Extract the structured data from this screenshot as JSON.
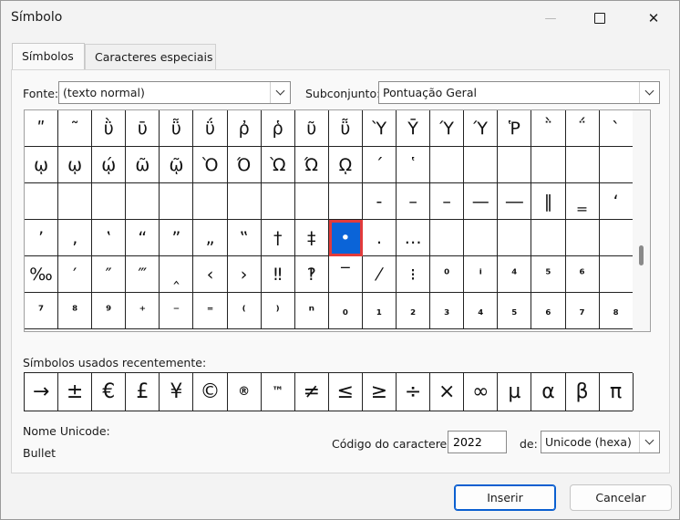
{
  "window": {
    "title": "Símbolo",
    "minimize_glyph": "—",
    "maximize_glyph": "☐",
    "close_glyph": "✕"
  },
  "tabs": [
    {
      "label": "Símbolos",
      "active": true
    },
    {
      "label": "Caracteres especiais",
      "active": false
    }
  ],
  "font": {
    "label": "Fonte:",
    "value": "(texto normal)"
  },
  "subset": {
    "label": "Subconjunto:",
    "value": "Pontuação Geral"
  },
  "symbol_grid": {
    "rows": [
      [
        "ʺ",
        "῀",
        "ῢ",
        "ῡ",
        "ῧ",
        "ΰ",
        "ῤ",
        "ῥ",
        "ῦ",
        "ῧ",
        "Ὺ",
        "Ῡ",
        "Ύ",
        "Ύ",
        "Ῥ",
        "῭",
        "΅",
        "`"
      ],
      [
        "ῳ",
        "ῳ",
        "ῴ",
        "ῶ",
        "ῷ",
        "Ὸ",
        "Ό",
        "Ὼ",
        "Ώ",
        "ῼ",
        "´",
        "῾",
        "",
        "",
        "",
        "",
        "",
        ""
      ],
      [
        "",
        "",
        "",
        "",
        "",
        "",
        "",
        "",
        "",
        "",
        "‐",
        "–",
        "–",
        "—",
        "―",
        "‖",
        "‗",
        "‘"
      ],
      [
        "’",
        "‚",
        "‛",
        "“",
        "”",
        "„",
        "‟",
        "†",
        "‡",
        "•",
        ".",
        "…",
        "",
        "",
        "",
        "",
        "",
        ""
      ],
      [
        "‰",
        "′",
        "″",
        "‴",
        "‸",
        "‹",
        "›",
        "‼",
        "‽",
        "‾",
        "⁄",
        "⁝",
        "⁰",
        "ⁱ",
        "⁴",
        "⁵",
        "⁶",
        ""
      ],
      [
        "⁷",
        "⁸",
        "⁹",
        "⁺",
        "⁻",
        "⁼",
        "⁽",
        "⁾",
        "ⁿ",
        "₀",
        "₁",
        "₂",
        "₃",
        "₄",
        "₅",
        "₆",
        "₇",
        "₈"
      ]
    ],
    "selected": {
      "row": 3,
      "col": 9
    }
  },
  "recent": {
    "label": "Símbolos usados recentemente:",
    "symbols": [
      "→",
      "±",
      "€",
      "£",
      "¥",
      "©",
      "®",
      "™",
      "≠",
      "≤",
      "≥",
      "÷",
      "×",
      "∞",
      "µ",
      "α",
      "β",
      "π"
    ]
  },
  "unicode_name": {
    "label": "Nome Unicode:",
    "value": "Bullet"
  },
  "char_code": {
    "label": "Código do caractere:",
    "value": "2022"
  },
  "from": {
    "label": "de:",
    "value": "Unicode (hexa)"
  },
  "buttons": {
    "insert": "Inserir",
    "cancel": "Cancelar"
  }
}
